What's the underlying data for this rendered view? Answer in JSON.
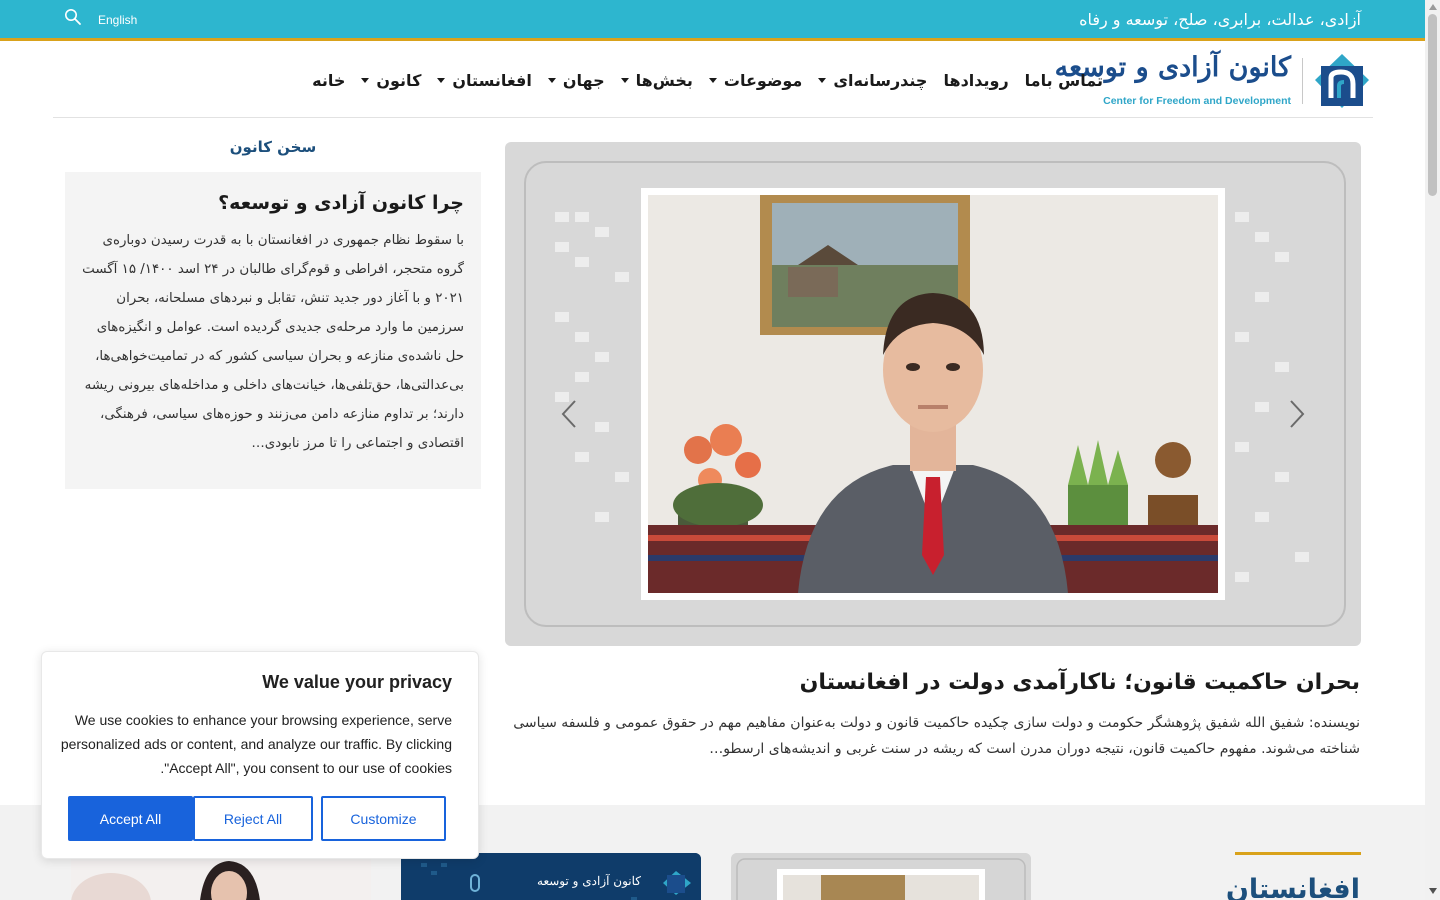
{
  "topbar": {
    "tagline": "آزادی، عدالت، برابری، صلح، توسعه و رفاه",
    "language": "English",
    "search_icon": "search-icon",
    "background": "#2db6cf",
    "accent": "#d9a21b"
  },
  "logo": {
    "fa_text": "کانون آزادی و توسعه",
    "en_text": "Center for Freedom and Development"
  },
  "nav": [
    {
      "label": "خانه",
      "dropdown": false
    },
    {
      "label": "کانون",
      "dropdown": true
    },
    {
      "label": "افغانستان",
      "dropdown": true
    },
    {
      "label": "جهان",
      "dropdown": true
    },
    {
      "label": "بخش‌ها",
      "dropdown": true
    },
    {
      "label": "موضوعات",
      "dropdown": true
    },
    {
      "label": "چندرسانه‌ای",
      "dropdown": true
    },
    {
      "label": "رویدادها",
      "dropdown": false
    },
    {
      "label": "تماس باما",
      "dropdown": false
    }
  ],
  "sidebar": {
    "title": "سخن کانون",
    "box_heading": "چرا کانون آزادی و توسعه؟",
    "box_text": "با سقوط نظام جمهوری در افغانستان با به قدرت رسیدن دوباره‌ی گروه متحجر، افراطی و قوم‌گرای طالبان در ۲۴ اسد ۱۴۰۰/ ۱۵ آگست ۲۰۲۱ و با آغاز دور جدید تنش، تقابل و نبردهای مسلحانه، بحران سرزمین ما وارد مرحله‌ی جدیدی گردیده است. عوامل و انگیزه‌های حل ناشده‌ی منازعه و بحران سیاسی کشور که در تمامیت‌خواهی‌ها، بی‌عدالتی‌ها، حق‌تلفی‌ها، خیانت‌های داخلی و مداخله‌های بیرونی ریشه دارند؛ بر تداوم منازعه دامن می‌زنند و حوزه‌های سیاسی، فرهنگی، اقتصادی و اجتماعی را تا مرز نابودی…"
  },
  "hero": {
    "prev_icon": "chevron-left-icon",
    "next_icon": "chevron-right-icon",
    "article_title": "بحران حاکمیت قانون؛ ناکارآمدی دولت در افغانستان",
    "article_excerpt": "نویسنده: شفیق الله شفیق پژوهشگر حکومت و دولت سازی  چکیده حاکمیت قانون و دولت به‌عنوان مفاهیم مهم در حقوق عمومی و فلسفه سیاسی شناخته می‌شوند. مفهوم حاکمیت قانون، نتیجه دوران مدرن است که ریشه در سنت غربی و اندیشه‌های ارسطو…"
  },
  "lower": {
    "section_heading": "افغانستان"
  },
  "cookie": {
    "title": "We value your privacy",
    "text": "We use cookies to enhance your browsing experience, serve personalized ads or content, and analyze our traffic. By clicking \"Accept All\", you consent to our use of cookies.",
    "accept_label": "Accept All",
    "reject_label": "Reject All",
    "customize_label": "Customize",
    "button_color": "#1863dc"
  }
}
